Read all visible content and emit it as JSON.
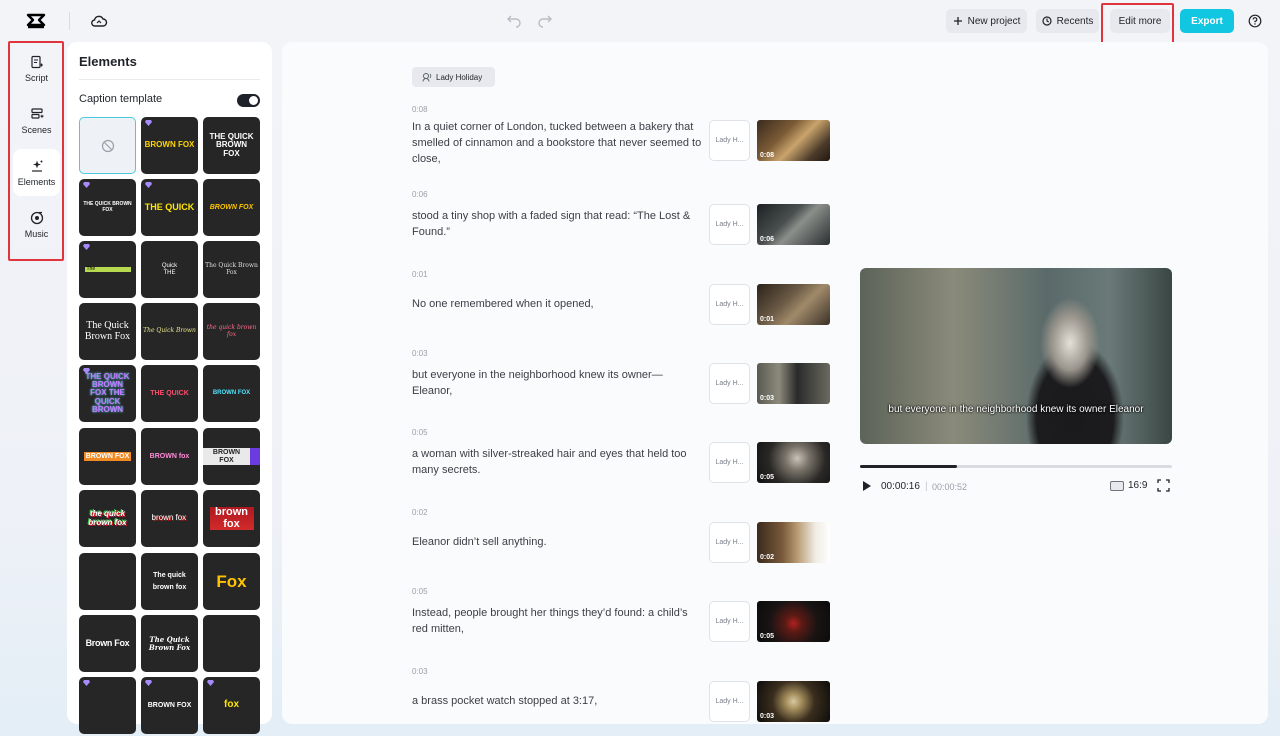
{
  "topbar": {
    "new_project": "New project",
    "recents": "Recents",
    "edit_more": "Edit more",
    "export": "Export",
    "icons": [
      "capcut-logo-icon",
      "cloud-icon",
      "undo-icon",
      "redo-icon",
      "plus-icon",
      "clock-icon",
      "help-icon"
    ]
  },
  "rail": {
    "items": [
      {
        "label": "Script",
        "icon": "script-icon"
      },
      {
        "label": "Scenes",
        "icon": "scenes-icon"
      },
      {
        "label": "Elements",
        "icon": "elements-icon"
      },
      {
        "label": "Music",
        "icon": "music-icon"
      }
    ],
    "active": "Elements"
  },
  "panel": {
    "title": "Elements",
    "caption_template_label": "Caption template",
    "caption_template_on": true,
    "tiles": [
      "",
      "BROWN FOX",
      "THE QUICK BROWN FOX",
      "THE QUICK BROWN FOX",
      "THE QUICK",
      "BROWN FOX",
      "The",
      "Quick THE",
      "The Quick Brown Fox",
      "The Quick Brown Fox",
      "The Quick Brown",
      "the quick brown fox",
      "THE QUICK BROWN FOX THE QUICK BROWN",
      "THE QUICK",
      "BROWN FOX",
      "BROWN FOX",
      "BROWN fox",
      "BROWN FOX",
      "the quick brown fox",
      "brown fox",
      "brown fox",
      "",
      "The quick brown fox",
      "Fox",
      "Brown Fox",
      "The Quick Brown Fox",
      "",
      "",
      "BROWN FOX",
      "fox"
    ]
  },
  "script": {
    "voice": "Lady Holiday",
    "scenes": [
      {
        "duration": "0:08",
        "text": "In a quiet corner of London, tucked between a bakery that smelled of cinnamon and a bookstore that never seemed to close,",
        "voice_short": "Lady H...",
        "thumb_time": "0:08"
      },
      {
        "duration": "0:06",
        "text": "stood a tiny shop with a faded sign that read: “The Lost & Found.”",
        "voice_short": "Lady H...",
        "thumb_time": "0:06"
      },
      {
        "duration": "0:01",
        "text": "No one remembered when it opened,",
        "voice_short": "Lady H...",
        "thumb_time": "0:01"
      },
      {
        "duration": "0:03",
        "text": "but everyone in the neighborhood knew its owner—Eleanor,",
        "voice_short": "Lady H...",
        "thumb_time": "0:03"
      },
      {
        "duration": "0:05",
        "text": "a woman with silver-streaked hair and eyes that held too many secrets.",
        "voice_short": "Lady H...",
        "thumb_time": "0:05"
      },
      {
        "duration": "0:02",
        "text": "Eleanor didn’t sell anything.",
        "voice_short": "Lady H...",
        "thumb_time": "0:02"
      },
      {
        "duration": "0:05",
        "text": "Instead, people brought her things they’d found: a child’s red mitten,",
        "voice_short": "Lady H...",
        "thumb_time": "0:05"
      },
      {
        "duration": "0:03",
        "text": "a brass pocket watch stopped at 3:17,",
        "voice_short": "Lady H...",
        "thumb_time": "0:03"
      }
    ]
  },
  "preview": {
    "subtitle": "but everyone in the neighborhood knew its owner Eleanor",
    "current_time": "00:00:16",
    "divider": "|",
    "total_time": "00:00:52",
    "progress": 0.31,
    "aspect_ratio": "16:9"
  },
  "colors": {
    "accent": "#11c6e1",
    "highlight": "#e0353d"
  }
}
